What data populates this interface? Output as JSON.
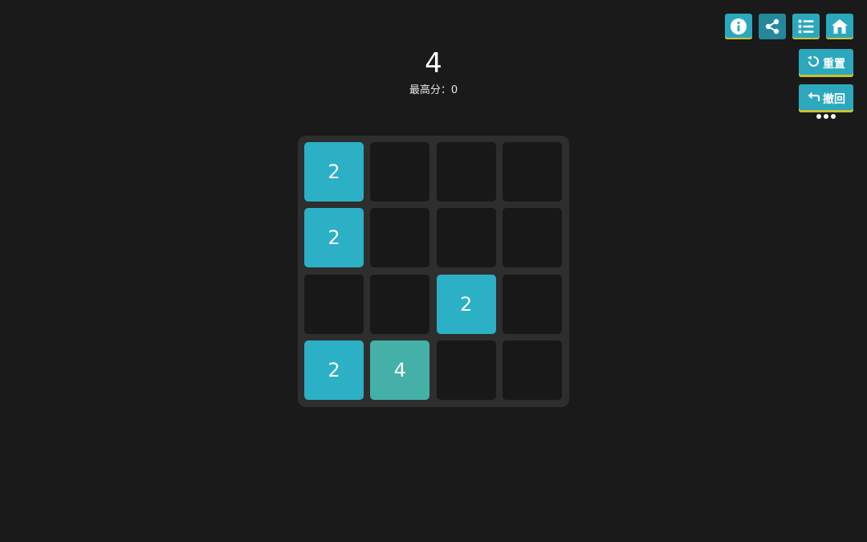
{
  "score": "4",
  "best_score": "最高分：0",
  "toolbar": {
    "icons": [
      "info-icon",
      "share-icon",
      "list-icon",
      "home-icon"
    ]
  },
  "buttons": {
    "reset_label": "重置",
    "undo_label": "撤回"
  },
  "colors": {
    "background": "#1a1a1a",
    "board": "#2e2e2e",
    "empty_cell": "#181818",
    "button": "#2ba8bd",
    "button_underline": "#c9c233",
    "tile_2": "#2bb0c6",
    "tile_4": "#45b0a8"
  },
  "board": {
    "size": 4,
    "grid": [
      [
        2,
        0,
        0,
        0
      ],
      [
        2,
        0,
        0,
        0
      ],
      [
        0,
        0,
        2,
        0
      ],
      [
        2,
        4,
        0,
        0
      ]
    ]
  }
}
